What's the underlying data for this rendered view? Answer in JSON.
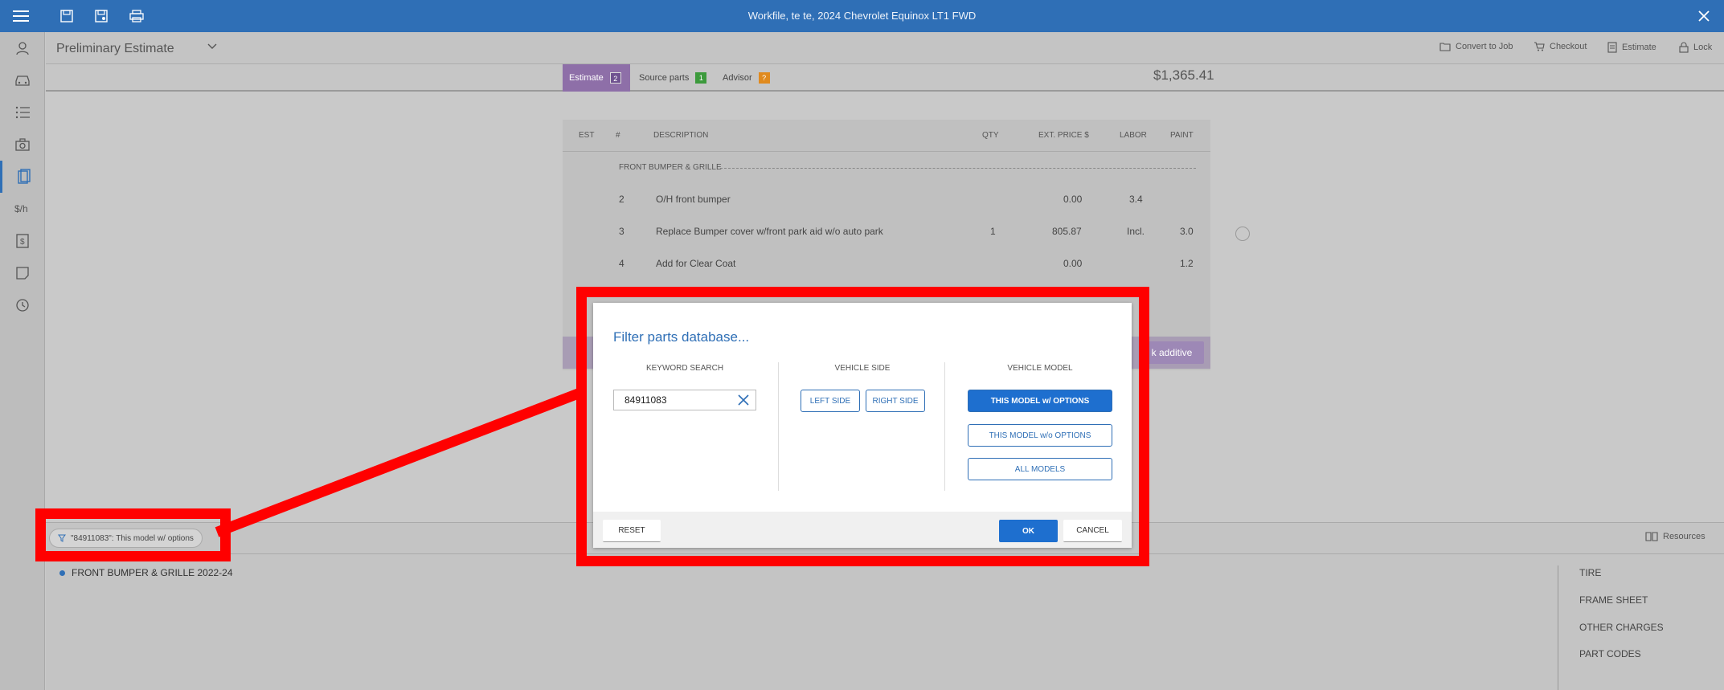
{
  "app": {
    "window_title": "Workfile, te te, 2024 Chevrolet Equinox LT1 FWD",
    "header_title": "Preliminary Estimate",
    "actions": [
      {
        "label": "Convert to Job",
        "icon": "folder-icon"
      },
      {
        "label": "Checkout",
        "icon": "cart-icon"
      },
      {
        "label": "Estimate",
        "icon": "document-icon"
      },
      {
        "label": "Lock",
        "icon": "lock-icon"
      }
    ]
  },
  "tabs": [
    {
      "label": "Estimate",
      "badge": "2",
      "badge_color": "#7a5a9a"
    },
    {
      "label": "Source parts",
      "badge": "1",
      "badge_color": "#3c9a3c"
    },
    {
      "label": "Advisor",
      "badge": "?",
      "badge_color": "#e08a1e"
    }
  ],
  "total": "$1,365.41",
  "estimate_table": {
    "columns": [
      "EST",
      "#",
      "DESCRIPTION",
      "QTY",
      "EXT. PRICE $",
      "LABOR",
      "PAINT"
    ],
    "section": "FRONT BUMPER & GRILLE",
    "rows": [
      {
        "num": "2",
        "desc": "O/H front bumper",
        "qty": "",
        "price": "0.00",
        "labor": "3.4",
        "paint": ""
      },
      {
        "num": "3",
        "desc": "Replace Bumper cover w/front park aid w/o auto park",
        "qty": "1",
        "price": "805.87",
        "labor": "Incl.",
        "paint": "3.0"
      },
      {
        "num": "4",
        "desc": "Add for Clear Coat",
        "qty": "",
        "price": "0.00",
        "labor": "",
        "paint": "1.2"
      }
    ],
    "additive_button": "k additive"
  },
  "dialog": {
    "title": "Filter parts database...",
    "keyword_label": "KEYWORD SEARCH",
    "keyword_value": "84911083",
    "side_label": "VEHICLE SIDE",
    "left_side": "LEFT SIDE",
    "right_side": "RIGHT SIDE",
    "model_label": "VEHICLE MODEL",
    "model_with_options": "THIS MODEL w/ OPTIONS",
    "model_without_options": "THIS MODEL w/o OPTIONS",
    "all_models": "ALL MODELS",
    "reset": "RESET",
    "ok": "OK",
    "cancel": "CANCEL"
  },
  "bottom": {
    "filter_chip": "\"84911083\": This model w/ options",
    "tree_item": "FRONT BUMPER & GRILLE 2022-24",
    "resources": "Resources",
    "right_links": [
      "TIRE",
      "FRAME SHEET",
      "OTHER CHARGES",
      "PART CODES"
    ]
  },
  "colors": {
    "topbar": "#2f6fb6",
    "accent": "#1e6fcf",
    "annotation": "#ff0000",
    "estimate_tab": "#8e6fa8"
  }
}
